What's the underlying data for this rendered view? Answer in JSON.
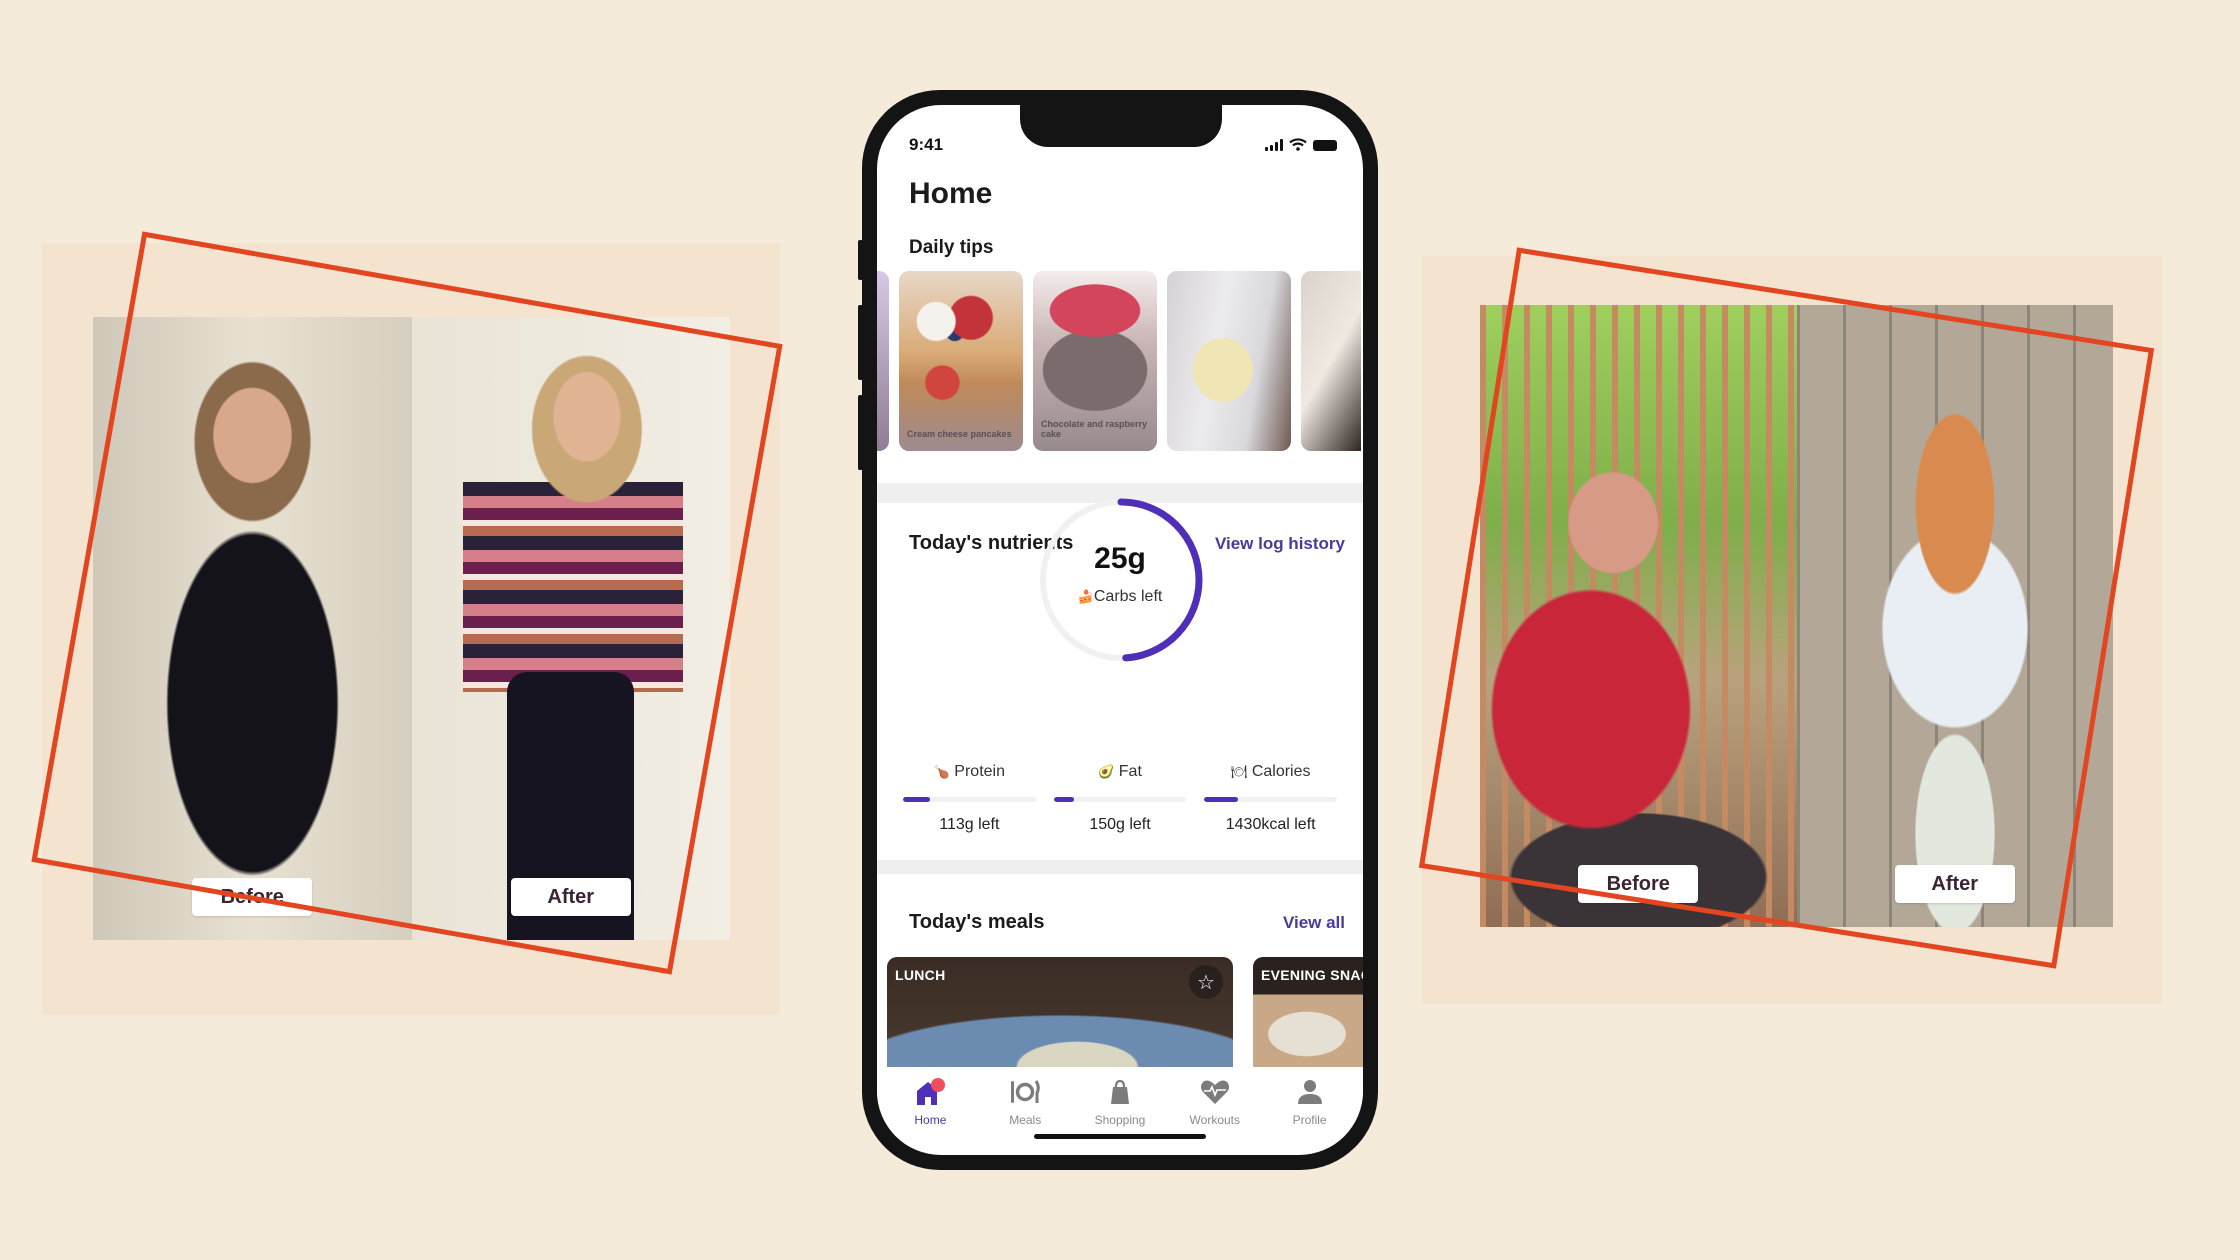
{
  "left_panel": {
    "before_label": "Before",
    "after_label": "After"
  },
  "right_panel": {
    "before_label": "Before",
    "after_label": "After"
  },
  "phone": {
    "status": {
      "time": "9:41"
    },
    "page_title": "Home",
    "daily_tips": {
      "title": "Daily tips",
      "cards": [
        {
          "title": "Cream cheese pancakes"
        },
        {
          "title": "Chocolate and raspberry cake"
        },
        {
          "title": ""
        },
        {
          "title": ""
        }
      ]
    },
    "nutrients": {
      "title": "Today's nutrients",
      "link": "View log history",
      "carbs": {
        "value": "25g",
        "label": "Carbs left",
        "icon": "🍰",
        "progress": 0.49
      },
      "macros": [
        {
          "name": "Protein",
          "icon": "🍗",
          "left": "113g left",
          "progress": 0.2
        },
        {
          "name": "Fat",
          "icon": "🥑",
          "left": "150g left",
          "progress": 0.15
        },
        {
          "name": "Calories",
          "icon": "🍽",
          "left": "1430kcal left",
          "progress": 0.25
        }
      ]
    },
    "meals": {
      "title": "Today's meals",
      "link": "View all",
      "cards": [
        {
          "tag": "LUNCH",
          "favorite_icon": "☆"
        },
        {
          "tag": "EVENING SNAC"
        }
      ]
    },
    "tabs": [
      {
        "label": "Home",
        "icon": "home-icon",
        "active": true
      },
      {
        "label": "Meals",
        "icon": "cutlery-icon",
        "active": false
      },
      {
        "label": "Shopping",
        "icon": "shopping-bag-icon",
        "active": false
      },
      {
        "label": "Workouts",
        "icon": "heart-pulse-icon",
        "active": false
      },
      {
        "label": "Profile",
        "icon": "person-icon",
        "active": false
      }
    ]
  },
  "colors": {
    "background": "#f5ebda",
    "panel": "#f3e3cf",
    "frame_accent": "#e2451f",
    "brand_purple": "#4f2fb8",
    "link_purple": "#4b3a9e",
    "label_text": "#3b2433",
    "notification_dot": "#ef4e5a"
  }
}
